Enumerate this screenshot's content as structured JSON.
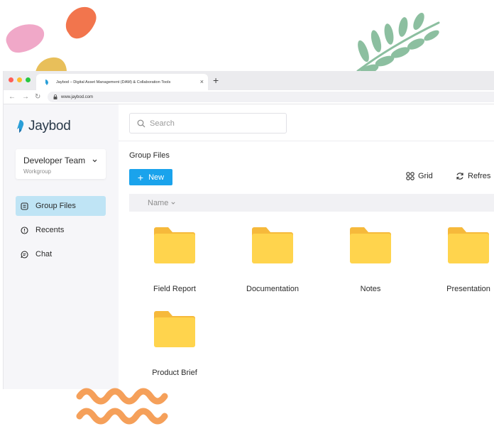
{
  "browser": {
    "tab_title": "Jaybod – Digital Asset Management (DAM) & Collaboration Tools",
    "new_tab_symbol": "+",
    "close_symbol": "×",
    "url": "www.jaybod.com",
    "window_dots": [
      "#ff5f57",
      "#febc2e",
      "#28c840"
    ]
  },
  "sidebar": {
    "logo_text": "Jaybod",
    "workspace": {
      "name": "Developer Team",
      "subtitle": "Workgroup"
    },
    "items": [
      {
        "label": "Group Files",
        "icon": "folder-box-icon",
        "active": true
      },
      {
        "label": "Recents",
        "icon": "clock-icon",
        "active": false
      },
      {
        "label": "Chat",
        "icon": "chat-icon",
        "active": false
      }
    ]
  },
  "main": {
    "search_placeholder": "Search",
    "section_title": "Group Files",
    "new_button": {
      "symbol": "+",
      "label": "New"
    },
    "view_buttons": {
      "grid": "Grid",
      "refresh": "Refres"
    },
    "column_header": "Name",
    "folders": [
      {
        "name": "Field Report"
      },
      {
        "name": "Documentation"
      },
      {
        "name": "Notes"
      },
      {
        "name": "Presentation"
      },
      {
        "name": "Product Brief"
      }
    ]
  },
  "colors": {
    "accent": "#1aa3ec",
    "active_nav": "#bfe4f5",
    "folder_front": "#ffd44d",
    "folder_back": "#f6b93b",
    "brand_blue": "#2a9fd8"
  }
}
